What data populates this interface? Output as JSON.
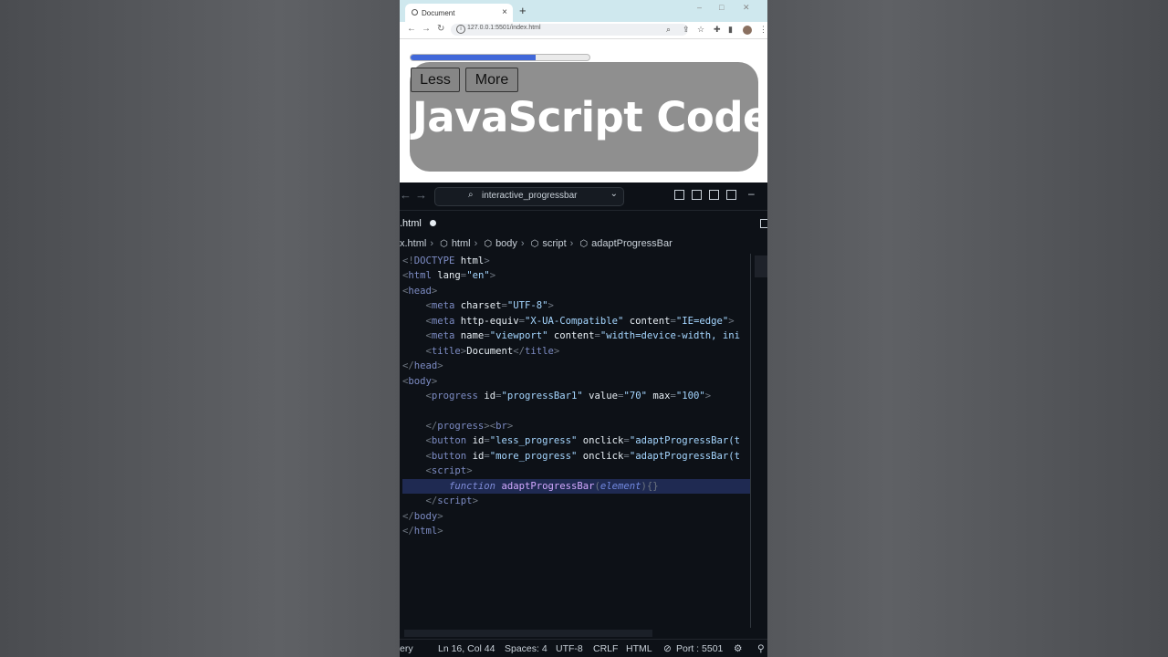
{
  "browser": {
    "tab_title": "Document",
    "tab_close": "×",
    "new_tab": "+",
    "url": "127.0.0.1:5501/index.html"
  },
  "page": {
    "progress_value": 70,
    "progress_max": 100,
    "less_label": "Less",
    "more_label": "More",
    "heading": "JavaScript Code"
  },
  "editor": {
    "command_center": "interactive_progressbar",
    "open_tab": ".html",
    "breadcrumb": {
      "file": "x.html",
      "items": [
        "html",
        "body",
        "script",
        "adaptProgressBar"
      ]
    },
    "code_lines": [
      [
        [
          "p",
          "<!"
        ],
        [
          "tag",
          "DOCTYPE"
        ],
        [
          "a",
          " html"
        ],
        [
          "p",
          ">"
        ]
      ],
      [
        [
          "p",
          "<"
        ],
        [
          "tag",
          "html"
        ],
        [
          "a",
          " lang"
        ],
        [
          "p",
          "="
        ],
        [
          "s",
          "\"en\""
        ],
        [
          "p",
          ">"
        ]
      ],
      [
        [
          "p",
          "<"
        ],
        [
          "tag",
          "head"
        ],
        [
          "p",
          ">"
        ]
      ],
      [
        [
          "a",
          "    "
        ],
        [
          "p",
          "<"
        ],
        [
          "tag",
          "meta"
        ],
        [
          "a",
          " charset"
        ],
        [
          "p",
          "="
        ],
        [
          "s",
          "\"UTF-8\""
        ],
        [
          "p",
          ">"
        ]
      ],
      [
        [
          "a",
          "    "
        ],
        [
          "p",
          "<"
        ],
        [
          "tag",
          "meta"
        ],
        [
          "a",
          " http-equiv"
        ],
        [
          "p",
          "="
        ],
        [
          "s",
          "\"X-UA-Compatible\""
        ],
        [
          "a",
          " content"
        ],
        [
          "p",
          "="
        ],
        [
          "s",
          "\"IE=edge\""
        ],
        [
          "p",
          ">"
        ]
      ],
      [
        [
          "a",
          "    "
        ],
        [
          "p",
          "<"
        ],
        [
          "tag",
          "meta"
        ],
        [
          "a",
          " name"
        ],
        [
          "p",
          "="
        ],
        [
          "s",
          "\"viewport\""
        ],
        [
          "a",
          " content"
        ],
        [
          "p",
          "="
        ],
        [
          "s",
          "\"width=device-width, ini"
        ]
      ],
      [
        [
          "a",
          "    "
        ],
        [
          "p",
          "<"
        ],
        [
          "tag",
          "title"
        ],
        [
          "p",
          ">"
        ],
        [
          "a",
          "Document"
        ],
        [
          "p",
          "</"
        ],
        [
          "tag",
          "title"
        ],
        [
          "p",
          ">"
        ]
      ],
      [
        [
          "p",
          "</"
        ],
        [
          "tag",
          "head"
        ],
        [
          "p",
          ">"
        ]
      ],
      [
        [
          "p",
          "<"
        ],
        [
          "tag",
          "body"
        ],
        [
          "p",
          ">"
        ]
      ],
      [
        [
          "a",
          "    "
        ],
        [
          "p",
          "<"
        ],
        [
          "tag",
          "progress"
        ],
        [
          "a",
          " id"
        ],
        [
          "p",
          "="
        ],
        [
          "s",
          "\"progressBar1\""
        ],
        [
          "a",
          " value"
        ],
        [
          "p",
          "="
        ],
        [
          "s",
          "\"70\""
        ],
        [
          "a",
          " max"
        ],
        [
          "p",
          "="
        ],
        [
          "s",
          "\"100\""
        ],
        [
          "p",
          ">"
        ]
      ],
      [
        [
          "a",
          ""
        ]
      ],
      [
        [
          "a",
          "    "
        ],
        [
          "p",
          "</"
        ],
        [
          "tag",
          "progress"
        ],
        [
          "p",
          "><"
        ],
        [
          "tag",
          "br"
        ],
        [
          "p",
          ">"
        ]
      ],
      [
        [
          "a",
          "    "
        ],
        [
          "p",
          "<"
        ],
        [
          "tag",
          "button"
        ],
        [
          "a",
          " id"
        ],
        [
          "p",
          "="
        ],
        [
          "s",
          "\"less_progress\""
        ],
        [
          "a",
          " onclick"
        ],
        [
          "p",
          "="
        ],
        [
          "s",
          "\"adaptProgressBar(t"
        ]
      ],
      [
        [
          "a",
          "    "
        ],
        [
          "p",
          "<"
        ],
        [
          "tag",
          "button"
        ],
        [
          "a",
          " id"
        ],
        [
          "p",
          "="
        ],
        [
          "s",
          "\"more_progress\""
        ],
        [
          "a",
          " onclick"
        ],
        [
          "p",
          "="
        ],
        [
          "s",
          "\"adaptProgressBar(t"
        ]
      ],
      [
        [
          "a",
          "    "
        ],
        [
          "p",
          "<"
        ],
        [
          "tag",
          "script"
        ],
        [
          "p",
          ">"
        ]
      ],
      [
        [
          "a",
          "        "
        ],
        [
          "kw",
          "function"
        ],
        [
          "fn",
          " adaptProgressBar"
        ],
        [
          "p",
          "("
        ],
        [
          "param",
          "element"
        ],
        [
          "p",
          "){}"
        ]
      ],
      [
        [
          "a",
          "    "
        ],
        [
          "p",
          "</"
        ],
        [
          "tag",
          "script"
        ],
        [
          "p",
          ">"
        ]
      ],
      [
        [
          "p",
          "</"
        ],
        [
          "tag",
          "body"
        ],
        [
          "p",
          ">"
        ]
      ],
      [
        [
          "p",
          "</"
        ],
        [
          "tag",
          "html"
        ],
        [
          "p",
          ">"
        ]
      ]
    ],
    "active_line_index": 15
  },
  "status": {
    "left": "ery",
    "position": "Ln 16, Col 44",
    "spaces": "Spaces: 4",
    "encoding": "UTF-8",
    "eol": "CRLF",
    "language": "HTML",
    "port": "Port : 5501"
  },
  "colors": {
    "progress_fill": "#4168d9",
    "card_bg": "#8f8f8f",
    "editor_bg": "#0d1117",
    "active_line": "#1f2a52"
  }
}
